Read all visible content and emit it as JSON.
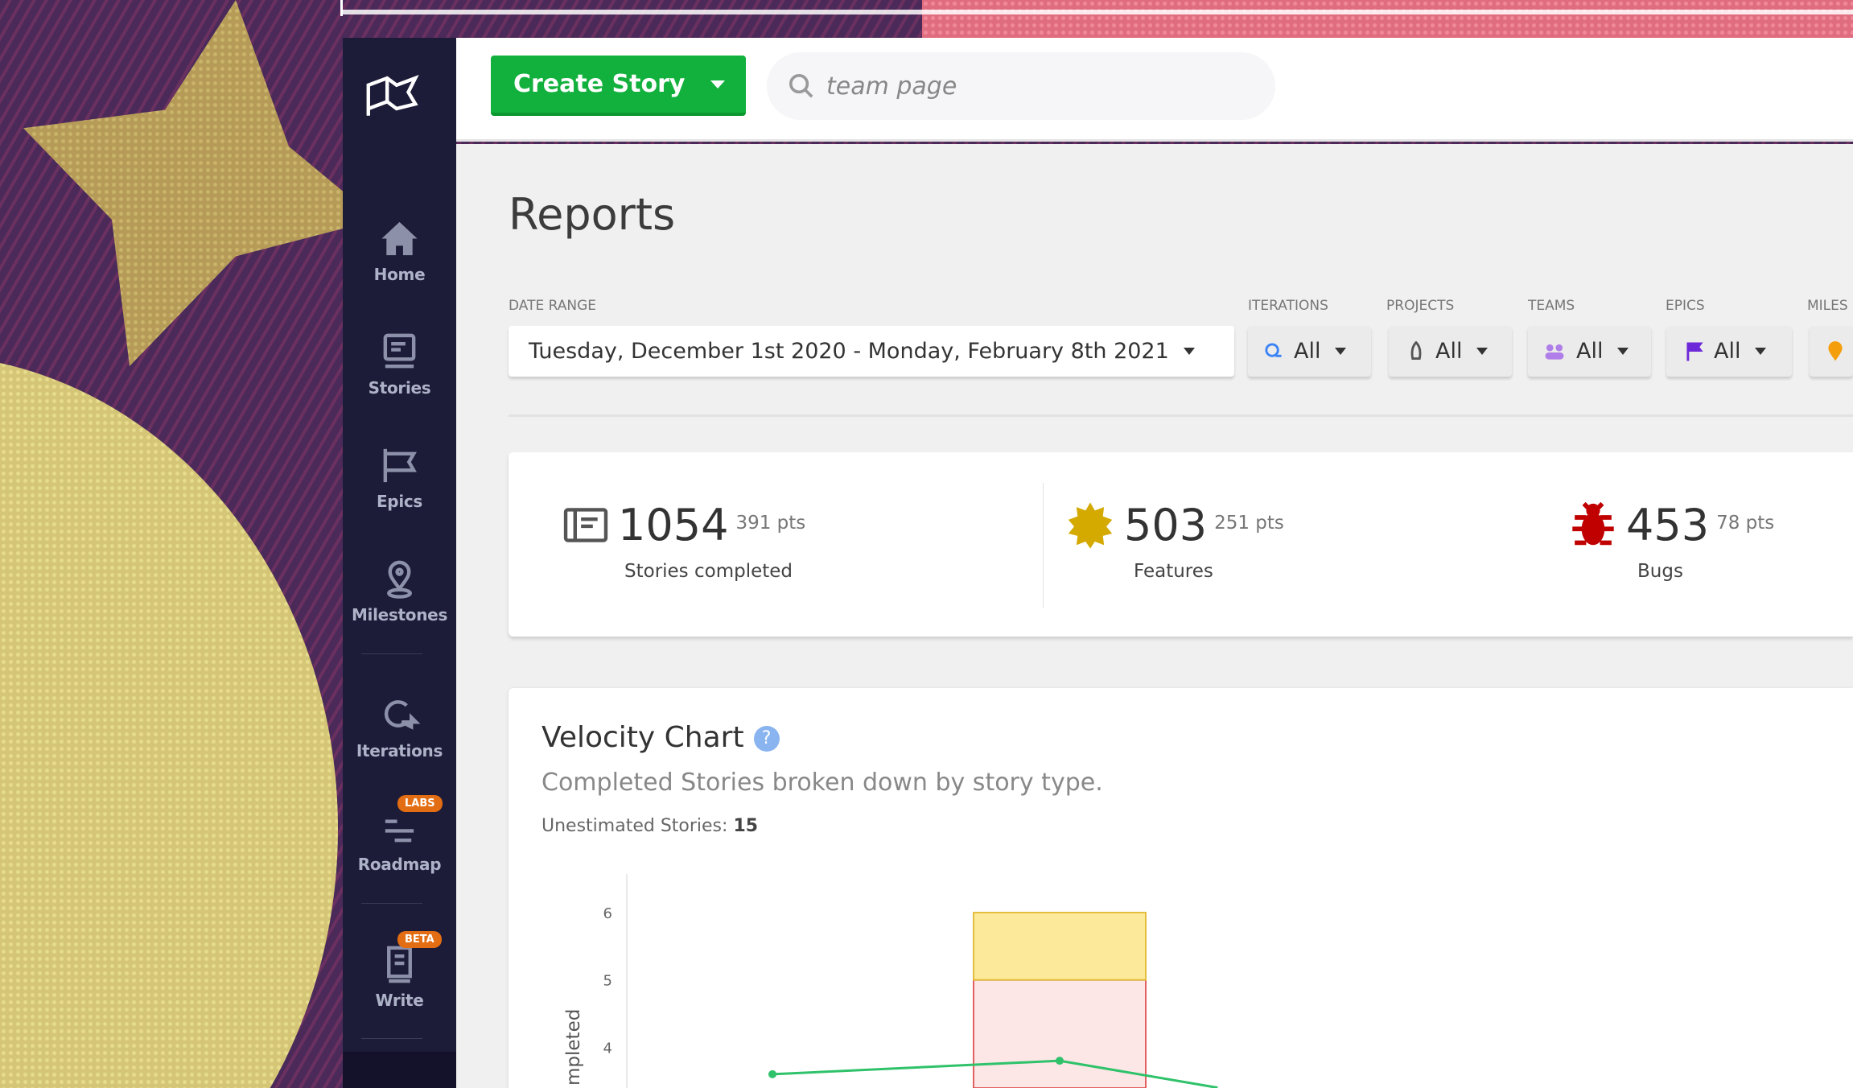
{
  "sidebar": {
    "items": [
      {
        "label": "Home",
        "icon": "home-icon"
      },
      {
        "label": "Stories",
        "icon": "stories-icon"
      },
      {
        "label": "Epics",
        "icon": "epics-flag-icon"
      },
      {
        "label": "Milestones",
        "icon": "map-pin-icon"
      },
      {
        "label": "Iterations",
        "icon": "iteration-cycle-icon"
      },
      {
        "label": "Roadmap",
        "icon": "roadmap-icon",
        "badge": "LABS"
      },
      {
        "label": "Write",
        "icon": "write-doc-icon",
        "badge": "BETA"
      }
    ]
  },
  "topbar": {
    "create_label": "Create Story",
    "search_value": "team page"
  },
  "page": {
    "title": "Reports"
  },
  "filters": {
    "date_range": {
      "label": "DATE RANGE",
      "value": "Tuesday, December 1st 2020 - Monday, February 8th 2021"
    },
    "iterations": {
      "label": "ITERATIONS",
      "value": "All"
    },
    "projects": {
      "label": "PROJECTS",
      "value": "All"
    },
    "teams": {
      "label": "TEAMS",
      "value": "All"
    },
    "epics": {
      "label": "EPICS",
      "value": "All"
    },
    "milestones": {
      "label": "MILES"
    }
  },
  "stats": [
    {
      "value": "1054",
      "pts": "391 pts",
      "caption": "Stories completed"
    },
    {
      "value": "503",
      "pts": "251 pts",
      "caption": "Features"
    },
    {
      "value": "453",
      "pts": "78 pts",
      "caption": "Bugs"
    }
  ],
  "velocity": {
    "title": "Velocity Chart",
    "help": "?",
    "subtitle": "Completed Stories broken down by story type.",
    "unestimated_label": "Unestimated Stories:",
    "unestimated_value": "15"
  },
  "colors": {
    "accent_green": "#12b03d",
    "sidebar": "#1c1b38",
    "feature": "#d4a900",
    "bug": "#c00000",
    "badge": "#e36d12"
  },
  "chart_data": {
    "type": "bar",
    "ylabel": "mpleted",
    "yticks": [
      4,
      5,
      6
    ],
    "ylim_visible": [
      3.4,
      6.6
    ],
    "stacked_bars": [
      {
        "index": 1,
        "segments": [
          {
            "type": "bug",
            "from": 0,
            "to": 5,
            "color": "#fde6e6",
            "stroke": "#e05050"
          },
          {
            "type": "feature",
            "from": 5,
            "to": 6,
            "color": "#fde99a",
            "stroke": "#e0b830"
          }
        ]
      }
    ],
    "line": {
      "color": "#2fc26a",
      "points": [
        {
          "index": 0,
          "y": 3.6
        },
        {
          "index": 1,
          "y": 3.8
        },
        {
          "index": 1.55,
          "y": 3.4
        }
      ]
    }
  }
}
